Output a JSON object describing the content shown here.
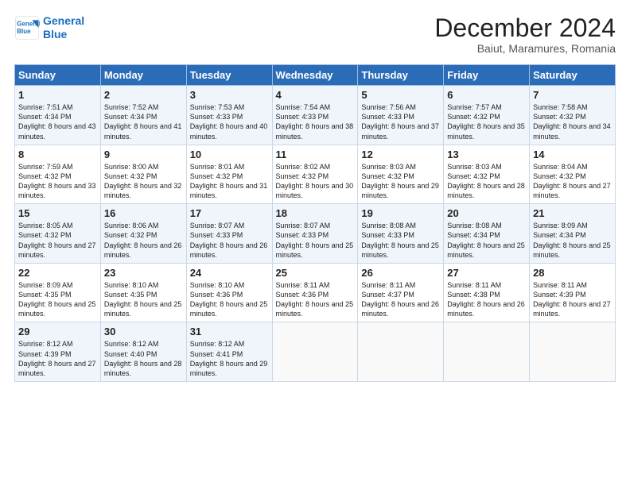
{
  "logo": {
    "line1": "General",
    "line2": "Blue"
  },
  "title": "December 2024",
  "subtitle": "Baiut, Maramures, Romania",
  "days_of_week": [
    "Sunday",
    "Monday",
    "Tuesday",
    "Wednesday",
    "Thursday",
    "Friday",
    "Saturday"
  ],
  "weeks": [
    [
      {
        "day": "1",
        "sunrise": "Sunrise: 7:51 AM",
        "sunset": "Sunset: 4:34 PM",
        "daylight": "Daylight: 8 hours and 43 minutes."
      },
      {
        "day": "2",
        "sunrise": "Sunrise: 7:52 AM",
        "sunset": "Sunset: 4:34 PM",
        "daylight": "Daylight: 8 hours and 41 minutes."
      },
      {
        "day": "3",
        "sunrise": "Sunrise: 7:53 AM",
        "sunset": "Sunset: 4:33 PM",
        "daylight": "Daylight: 8 hours and 40 minutes."
      },
      {
        "day": "4",
        "sunrise": "Sunrise: 7:54 AM",
        "sunset": "Sunset: 4:33 PM",
        "daylight": "Daylight: 8 hours and 38 minutes."
      },
      {
        "day": "5",
        "sunrise": "Sunrise: 7:56 AM",
        "sunset": "Sunset: 4:33 PM",
        "daylight": "Daylight: 8 hours and 37 minutes."
      },
      {
        "day": "6",
        "sunrise": "Sunrise: 7:57 AM",
        "sunset": "Sunset: 4:32 PM",
        "daylight": "Daylight: 8 hours and 35 minutes."
      },
      {
        "day": "7",
        "sunrise": "Sunrise: 7:58 AM",
        "sunset": "Sunset: 4:32 PM",
        "daylight": "Daylight: 8 hours and 34 minutes."
      }
    ],
    [
      {
        "day": "8",
        "sunrise": "Sunrise: 7:59 AM",
        "sunset": "Sunset: 4:32 PM",
        "daylight": "Daylight: 8 hours and 33 minutes."
      },
      {
        "day": "9",
        "sunrise": "Sunrise: 8:00 AM",
        "sunset": "Sunset: 4:32 PM",
        "daylight": "Daylight: 8 hours and 32 minutes."
      },
      {
        "day": "10",
        "sunrise": "Sunrise: 8:01 AM",
        "sunset": "Sunset: 4:32 PM",
        "daylight": "Daylight: 8 hours and 31 minutes."
      },
      {
        "day": "11",
        "sunrise": "Sunrise: 8:02 AM",
        "sunset": "Sunset: 4:32 PM",
        "daylight": "Daylight: 8 hours and 30 minutes."
      },
      {
        "day": "12",
        "sunrise": "Sunrise: 8:03 AM",
        "sunset": "Sunset: 4:32 PM",
        "daylight": "Daylight: 8 hours and 29 minutes."
      },
      {
        "day": "13",
        "sunrise": "Sunrise: 8:03 AM",
        "sunset": "Sunset: 4:32 PM",
        "daylight": "Daylight: 8 hours and 28 minutes."
      },
      {
        "day": "14",
        "sunrise": "Sunrise: 8:04 AM",
        "sunset": "Sunset: 4:32 PM",
        "daylight": "Daylight: 8 hours and 27 minutes."
      }
    ],
    [
      {
        "day": "15",
        "sunrise": "Sunrise: 8:05 AM",
        "sunset": "Sunset: 4:32 PM",
        "daylight": "Daylight: 8 hours and 27 minutes."
      },
      {
        "day": "16",
        "sunrise": "Sunrise: 8:06 AM",
        "sunset": "Sunset: 4:32 PM",
        "daylight": "Daylight: 8 hours and 26 minutes."
      },
      {
        "day": "17",
        "sunrise": "Sunrise: 8:07 AM",
        "sunset": "Sunset: 4:33 PM",
        "daylight": "Daylight: 8 hours and 26 minutes."
      },
      {
        "day": "18",
        "sunrise": "Sunrise: 8:07 AM",
        "sunset": "Sunset: 4:33 PM",
        "daylight": "Daylight: 8 hours and 25 minutes."
      },
      {
        "day": "19",
        "sunrise": "Sunrise: 8:08 AM",
        "sunset": "Sunset: 4:33 PM",
        "daylight": "Daylight: 8 hours and 25 minutes."
      },
      {
        "day": "20",
        "sunrise": "Sunrise: 8:08 AM",
        "sunset": "Sunset: 4:34 PM",
        "daylight": "Daylight: 8 hours and 25 minutes."
      },
      {
        "day": "21",
        "sunrise": "Sunrise: 8:09 AM",
        "sunset": "Sunset: 4:34 PM",
        "daylight": "Daylight: 8 hours and 25 minutes."
      }
    ],
    [
      {
        "day": "22",
        "sunrise": "Sunrise: 8:09 AM",
        "sunset": "Sunset: 4:35 PM",
        "daylight": "Daylight: 8 hours and 25 minutes."
      },
      {
        "day": "23",
        "sunrise": "Sunrise: 8:10 AM",
        "sunset": "Sunset: 4:35 PM",
        "daylight": "Daylight: 8 hours and 25 minutes."
      },
      {
        "day": "24",
        "sunrise": "Sunrise: 8:10 AM",
        "sunset": "Sunset: 4:36 PM",
        "daylight": "Daylight: 8 hours and 25 minutes."
      },
      {
        "day": "25",
        "sunrise": "Sunrise: 8:11 AM",
        "sunset": "Sunset: 4:36 PM",
        "daylight": "Daylight: 8 hours and 25 minutes."
      },
      {
        "day": "26",
        "sunrise": "Sunrise: 8:11 AM",
        "sunset": "Sunset: 4:37 PM",
        "daylight": "Daylight: 8 hours and 26 minutes."
      },
      {
        "day": "27",
        "sunrise": "Sunrise: 8:11 AM",
        "sunset": "Sunset: 4:38 PM",
        "daylight": "Daylight: 8 hours and 26 minutes."
      },
      {
        "day": "28",
        "sunrise": "Sunrise: 8:11 AM",
        "sunset": "Sunset: 4:39 PM",
        "daylight": "Daylight: 8 hours and 27 minutes."
      }
    ],
    [
      {
        "day": "29",
        "sunrise": "Sunrise: 8:12 AM",
        "sunset": "Sunset: 4:39 PM",
        "daylight": "Daylight: 8 hours and 27 minutes."
      },
      {
        "day": "30",
        "sunrise": "Sunrise: 8:12 AM",
        "sunset": "Sunset: 4:40 PM",
        "daylight": "Daylight: 8 hours and 28 minutes."
      },
      {
        "day": "31",
        "sunrise": "Sunrise: 8:12 AM",
        "sunset": "Sunset: 4:41 PM",
        "daylight": "Daylight: 8 hours and 29 minutes."
      },
      null,
      null,
      null,
      null
    ]
  ]
}
